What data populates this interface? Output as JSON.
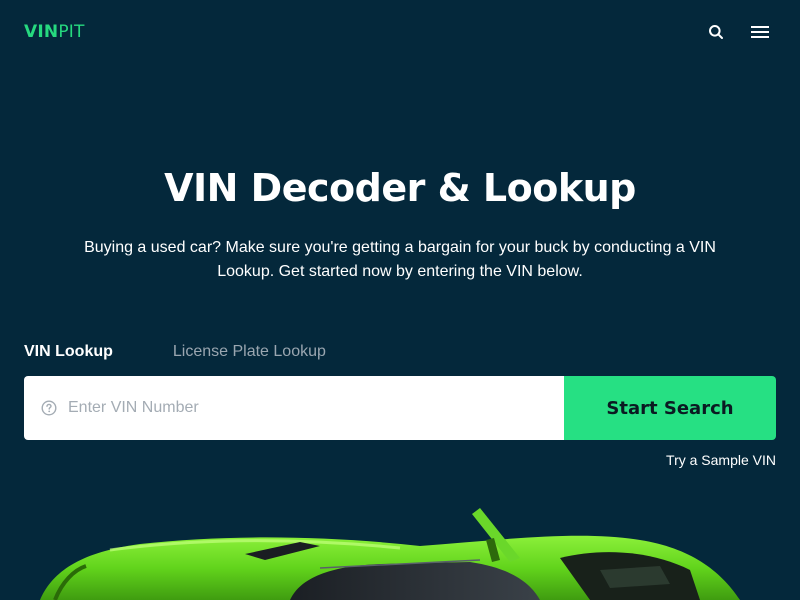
{
  "header": {
    "logo_strong": "VIN",
    "logo_light": "PIT",
    "search_icon": "search-icon",
    "menu_icon": "hamburger-menu-icon"
  },
  "hero": {
    "title": "VIN Decoder & Lookup",
    "subtitle": "Buying a used car? Make sure you're getting a bargain for your buck by conducting a VIN Lookup. Get started now by entering the VIN below."
  },
  "tabs": [
    {
      "label": "VIN Lookup",
      "active": true
    },
    {
      "label": "License Plate Lookup",
      "active": false
    }
  ],
  "search": {
    "placeholder": "Enter VIN Number",
    "value": "",
    "help_icon": "question-circle-icon",
    "button_label": "Start Search",
    "sample_link": "Try a Sample VIN"
  },
  "colors": {
    "background": "#04283b",
    "accent": "#26e083",
    "text": "#ffffff",
    "muted": "#9aa6b0"
  },
  "hero_image": "green-sports-car"
}
